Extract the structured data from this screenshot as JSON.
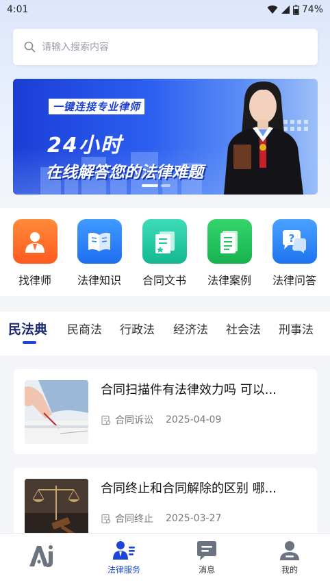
{
  "status_bar": {
    "time": "4:01",
    "battery": "74%"
  },
  "search": {
    "placeholder": "请输入搜索内容"
  },
  "banner": {
    "tagline": "一键连接专业律师",
    "hours": "24小时",
    "headline": "在线解答您的法律难题"
  },
  "categories": [
    {
      "label": "找律师",
      "icon": "lawyer-icon",
      "color": "#ff6a2b"
    },
    {
      "label": "法律知识",
      "icon": "book-icon",
      "color": "#2f84f6"
    },
    {
      "label": "合同文书",
      "icon": "contract-icon",
      "color": "#1fc9a3"
    },
    {
      "label": "法律案例",
      "icon": "document-icon",
      "color": "#22c55e"
    },
    {
      "label": "法律问答",
      "icon": "qa-icon",
      "color": "#2f8af6"
    }
  ],
  "tabs": [
    {
      "label": "民法典",
      "active": true
    },
    {
      "label": "民商法"
    },
    {
      "label": "行政法"
    },
    {
      "label": "经济法"
    },
    {
      "label": "社会法"
    },
    {
      "label": "刑事法"
    }
  ],
  "articles": [
    {
      "title": "合同扫描件有法律效力吗 可以...",
      "tag": "合同诉讼",
      "date": "2025-04-09"
    },
    {
      "title": "合同终止和合同解除的区别 哪...",
      "tag": "合同终止",
      "date": "2025-03-27"
    }
  ],
  "bottom_nav": [
    {
      "label": "",
      "icon": "ai-logo-icon"
    },
    {
      "label": "法律服务",
      "icon": "legal-service-icon",
      "active": true
    },
    {
      "label": "消息",
      "icon": "message-icon"
    },
    {
      "label": "我的",
      "icon": "profile-icon"
    }
  ],
  "colors": {
    "primary": "#1d44d8",
    "banner": "#2c5ff0"
  }
}
